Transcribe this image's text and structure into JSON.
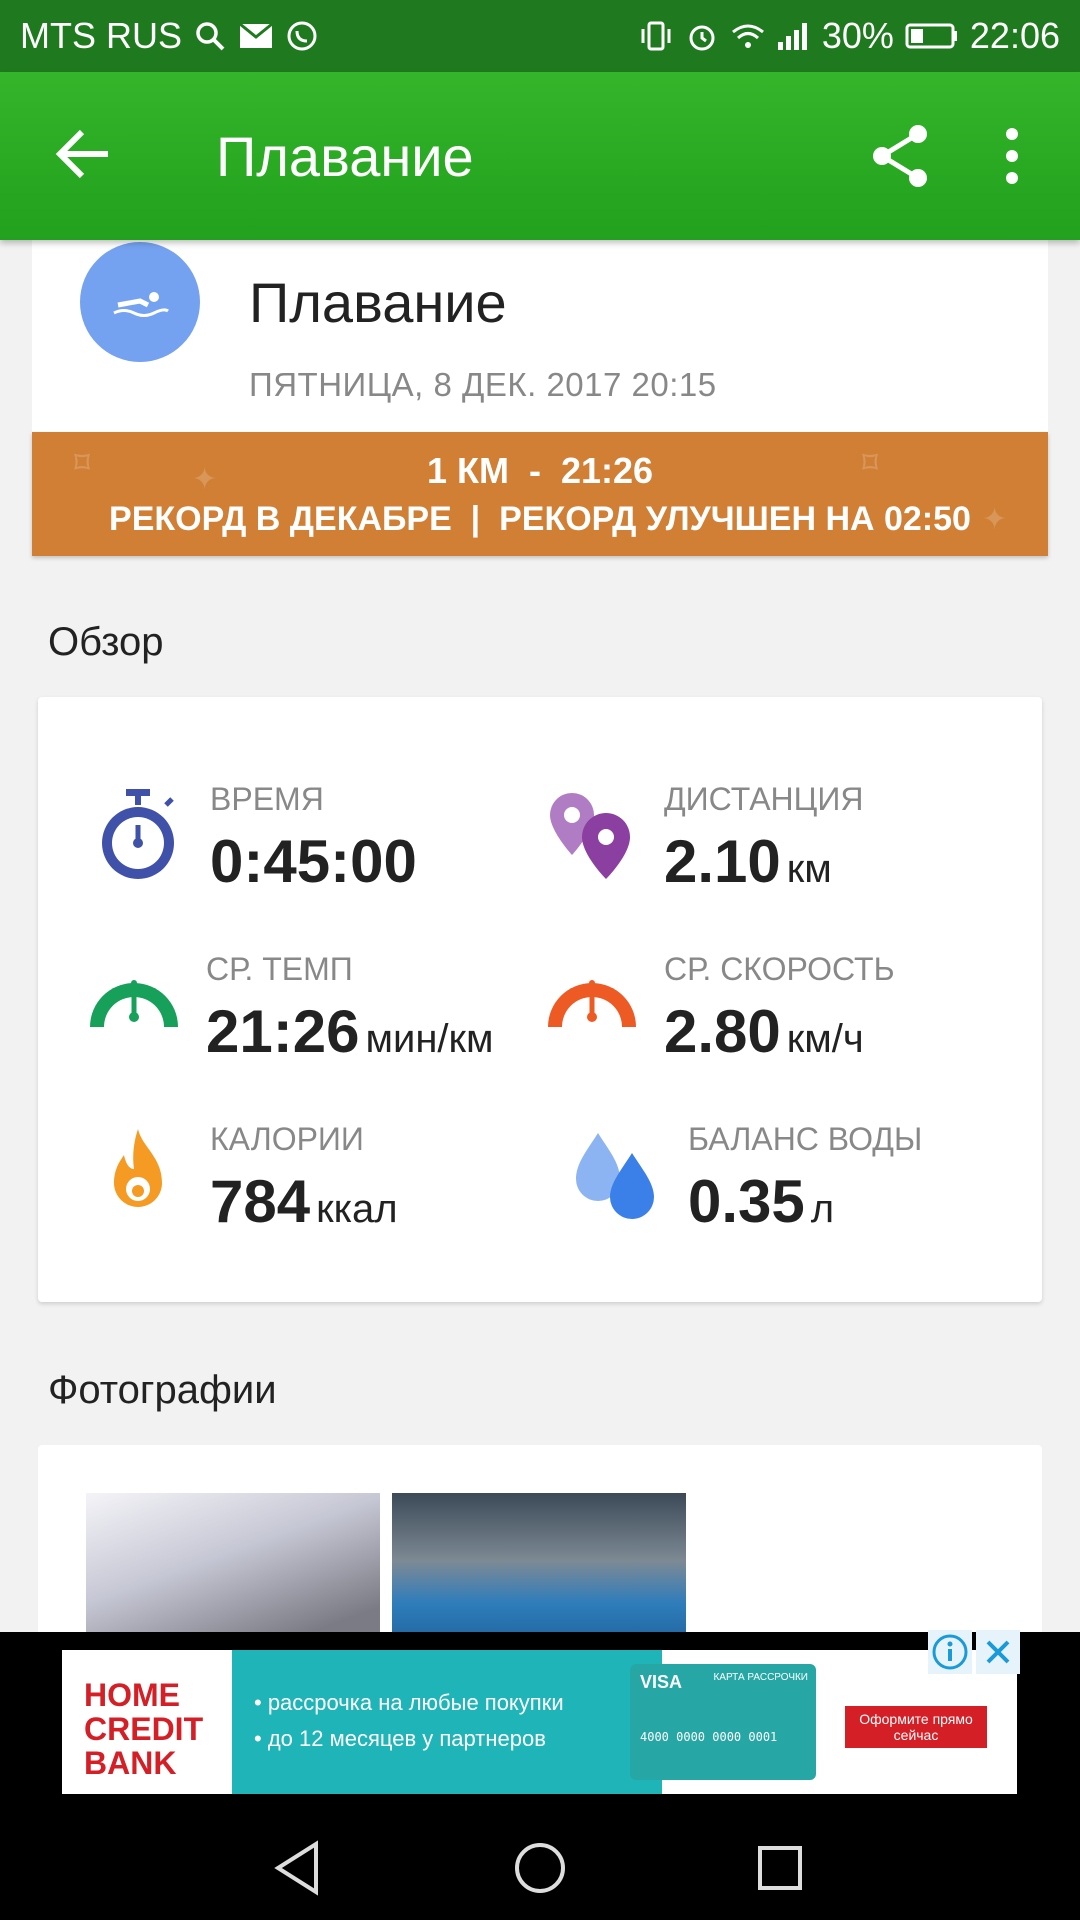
{
  "status_bar": {
    "carrier": "MTS RUS",
    "battery": "30%",
    "time": "22:06"
  },
  "app_bar": {
    "title": "Плавание"
  },
  "activity": {
    "title": "Плавание",
    "date": "ПЯТНИЦА, 8 ДЕК. 2017 20:15"
  },
  "record": {
    "line1": "1 КМ  -  21:26",
    "line2": "РЕКОРД В ДЕКАБРЕ  |  РЕКОРД УЛУЧШЕН НА 02:50"
  },
  "overview": {
    "title": "Обзор",
    "stats": [
      {
        "label": "ВРЕМЯ",
        "value": "0:45:00",
        "unit": "",
        "icon": "stopwatch-icon",
        "color": "#3f51a8"
      },
      {
        "label": "ДИСТАНЦИЯ",
        "value": "2.10",
        "unit": "км",
        "icon": "map-pin-icon",
        "color": "#8b3fa0"
      },
      {
        "label": "СР. ТЕМП",
        "value": "21:26",
        "unit": "мин/км",
        "icon": "speedometer-icon",
        "color": "#16a05a"
      },
      {
        "label": "СР. СКОРОСТЬ",
        "value": "2.80",
        "unit": "км/ч",
        "icon": "speedometer-icon",
        "color": "#ee5a24"
      },
      {
        "label": "КАЛОРИИ",
        "value": "784",
        "unit": "ккал",
        "icon": "flame-icon",
        "color": "#f59a23"
      },
      {
        "label": "БАЛАНС ВОДЫ",
        "value": "0.35",
        "unit": "л",
        "icon": "water-drops-icon",
        "color": "#3b7fe8"
      }
    ]
  },
  "photos": {
    "title": "Фотографии"
  },
  "ad": {
    "logo_line1": "HOME",
    "logo_line2": "CREDIT",
    "logo_line3": "BANK",
    "text1": "• рассрочка на любые покупки",
    "text2": "• до 12 месяцев у партнеров",
    "card_brand": "VISA",
    "card_label": "КАРТА РАССРОЧКИ",
    "card_number": "4000 0000 0000 0001",
    "cta": "Оформите прямо сейчас"
  }
}
